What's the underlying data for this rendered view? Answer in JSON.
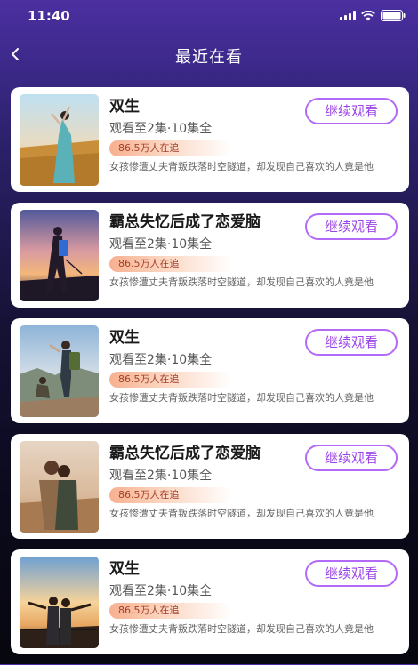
{
  "status_bar": {
    "time": "11:40"
  },
  "header": {
    "title": "最近在看"
  },
  "items": [
    {
      "title": "双生",
      "progress": "观看至2集·10集全",
      "badge": "86.5万人在追",
      "desc": "女孩惨遭丈夫背叛跌落时空隧道，却发现自己喜欢的人竟是他",
      "button": "继续观看",
      "thumb": "woman-on-cliff-photo"
    },
    {
      "title": "霸总失忆后成了恋爱脑",
      "progress": "观看至2集·10集全",
      "badge": "86.5万人在追",
      "desc": "女孩惨遭丈夫背叛跌落时空隧道，却发现自己喜欢的人竟是他",
      "button": "继续观看",
      "thumb": "hiker-silhouette-photo"
    },
    {
      "title": "双生",
      "progress": "观看至2集·10集全",
      "badge": "86.5万人在追",
      "desc": "女孩惨遭丈夫背叛跌落时空隧道，却发现自己喜欢的人竟是他",
      "button": "继续观看",
      "thumb": "couple-on-rock-photo"
    },
    {
      "title": "霸总失忆后成了恋爱脑",
      "progress": "观看至2集·10集全",
      "badge": "86.5万人在追",
      "desc": "女孩惨遭丈夫背叛跌落时空隧道，却发现自己喜欢的人竟是他",
      "button": "继续观看",
      "thumb": "couple-embrace-photo"
    },
    {
      "title": "双生",
      "progress": "观看至2集·10集全",
      "badge": "86.5万人在追",
      "desc": "女孩惨遭丈夫背叛跌落时空隧道，却发现自己喜欢的人竟是他",
      "button": "继续观看",
      "thumb": "couple-on-bridge-photo"
    }
  ]
}
